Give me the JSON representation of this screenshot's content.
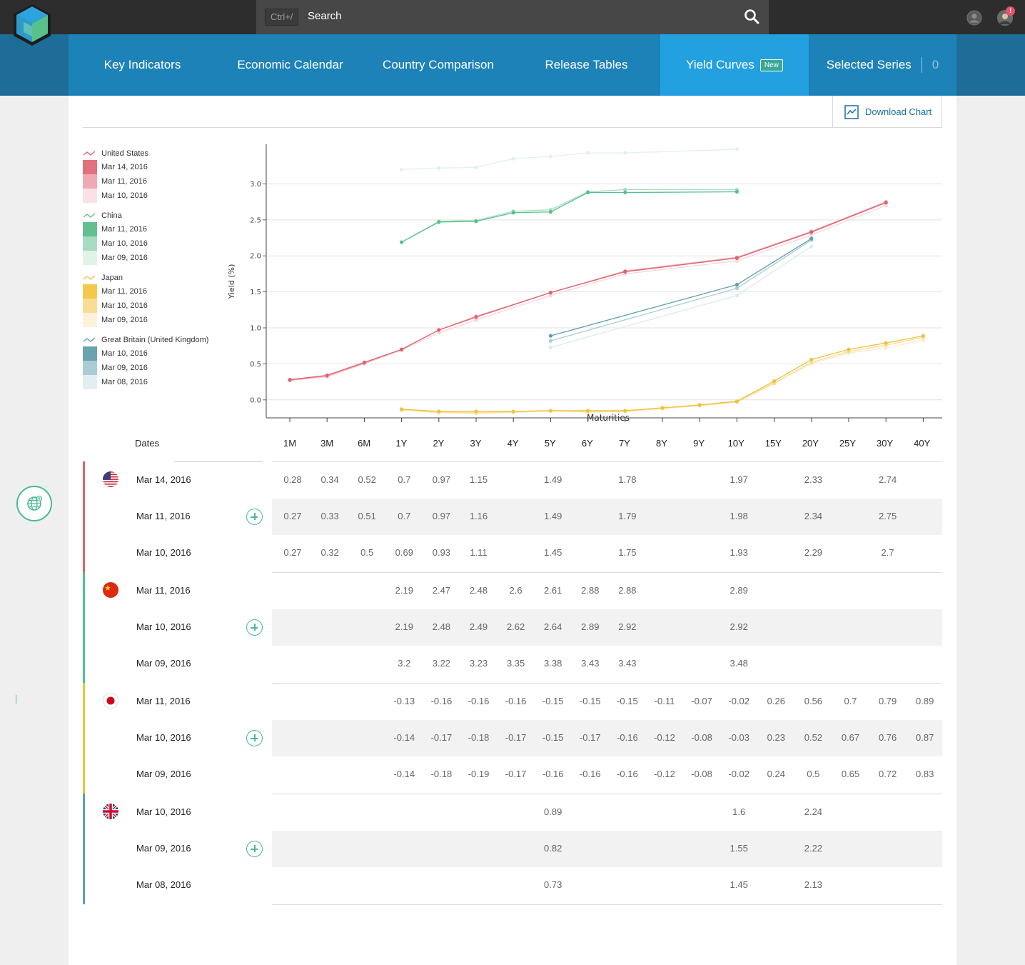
{
  "search": {
    "shortcut": "Ctrl+/",
    "label": "Search"
  },
  "nav": {
    "items": [
      {
        "label": "Key Indicators"
      },
      {
        "label": "Economic Calendar"
      },
      {
        "label": "Country Comparison"
      },
      {
        "label": "Release Tables"
      },
      {
        "label": "Yield Curves",
        "badge": "New"
      },
      {
        "label": "Selected Series",
        "count": "0"
      }
    ]
  },
  "avatar_badge": "!",
  "download_label": "Download Chart",
  "legend": [
    {
      "country": "United States",
      "color": "#e0606f",
      "dates": [
        "Mar 14, 2016",
        "Mar 11, 2016",
        "Mar 10, 2016"
      ],
      "shades": [
        "#e3707f",
        "#eeaab3",
        "#fae1e4"
      ]
    },
    {
      "country": "China",
      "color": "#57c08d",
      "dates": [
        "Mar 11, 2016",
        "Mar 10, 2016",
        "Mar 09, 2016"
      ],
      "shades": [
        "#62c090",
        "#a8dcc0",
        "#e0f3e8"
      ]
    },
    {
      "country": "Japan",
      "color": "#f0c23c",
      "dates": [
        "Mar 11, 2016",
        "Mar 10, 2016",
        "Mar 09, 2016"
      ],
      "shades": [
        "#f4c84a",
        "#f8dd94",
        "#fdf2d9"
      ]
    },
    {
      "country": "Great Britain (United Kingdom)",
      "color": "#5e9fac",
      "dates": [
        "Mar 10, 2016",
        "Mar 09, 2016",
        "Mar 08, 2016"
      ],
      "shades": [
        "#6aa3b0",
        "#aaccd3",
        "#e2eef0"
      ]
    }
  ],
  "chart_data": {
    "type": "line",
    "ylabel": "Yield (%)",
    "xlabel": "Maturities",
    "ylim": [
      -0.25,
      3.55
    ],
    "yticks": [
      "0.0",
      "0.5",
      "1.0",
      "1.5",
      "2.0",
      "2.5",
      "3.0"
    ],
    "x": [
      "1M",
      "3M",
      "6M",
      "1Y",
      "2Y",
      "3Y",
      "4Y",
      "5Y",
      "6Y",
      "7Y",
      "8Y",
      "9Y",
      "10Y",
      "15Y",
      "20Y",
      "25Y",
      "30Y",
      "40Y"
    ],
    "series": [
      {
        "name": "United States Mar 14, 2016",
        "color": "#e0606f",
        "values": [
          0.28,
          0.34,
          0.52,
          0.7,
          0.97,
          1.15,
          null,
          1.49,
          null,
          1.78,
          null,
          null,
          1.97,
          null,
          2.33,
          null,
          2.74,
          null
        ]
      },
      {
        "name": "United States Mar 11, 2016",
        "color": "#eeaab3",
        "values": [
          0.27,
          0.33,
          0.51,
          0.7,
          0.97,
          1.16,
          null,
          1.49,
          null,
          1.79,
          null,
          null,
          1.98,
          null,
          2.34,
          null,
          2.75,
          null
        ]
      },
      {
        "name": "United States Mar 10, 2016",
        "color": "#f7d6db",
        "values": [
          0.27,
          0.32,
          0.5,
          0.69,
          0.93,
          1.11,
          null,
          1.45,
          null,
          1.75,
          null,
          null,
          1.93,
          null,
          2.29,
          null,
          2.7,
          null
        ]
      },
      {
        "name": "China Mar 11, 2016",
        "color": "#57c08d",
        "values": [
          null,
          null,
          null,
          2.19,
          2.47,
          2.48,
          2.6,
          2.61,
          2.88,
          2.88,
          null,
          null,
          2.89,
          null,
          null,
          null,
          null,
          null
        ]
      },
      {
        "name": "China Mar 10, 2016",
        "color": "#a8dcc0",
        "values": [
          null,
          null,
          null,
          2.19,
          2.48,
          2.49,
          2.62,
          2.64,
          2.89,
          2.92,
          null,
          null,
          2.92,
          null,
          null,
          null,
          null,
          null
        ]
      },
      {
        "name": "China Mar 09, 2016",
        "color": "#dff2e8",
        "values": [
          null,
          null,
          null,
          3.2,
          3.22,
          3.23,
          3.35,
          3.38,
          3.43,
          3.43,
          null,
          null,
          3.48,
          null,
          null,
          null,
          null,
          null
        ]
      },
      {
        "name": "Japan Mar 11, 2016",
        "color": "#f0c23c",
        "values": [
          null,
          null,
          null,
          -0.13,
          -0.16,
          -0.16,
          -0.16,
          -0.15,
          -0.15,
          -0.15,
          -0.11,
          -0.07,
          -0.02,
          0.26,
          0.56,
          0.7,
          0.79,
          0.89
        ]
      },
      {
        "name": "Japan Mar 10, 2016",
        "color": "#f8dd94",
        "values": [
          null,
          null,
          null,
          -0.14,
          -0.17,
          -0.18,
          -0.17,
          -0.15,
          -0.17,
          -0.16,
          -0.12,
          -0.08,
          -0.03,
          0.23,
          0.52,
          0.67,
          0.76,
          0.87
        ]
      },
      {
        "name": "Japan Mar 09, 2016",
        "color": "#fbeccc",
        "values": [
          null,
          null,
          null,
          -0.14,
          -0.18,
          -0.19,
          -0.17,
          -0.16,
          -0.16,
          -0.16,
          -0.12,
          -0.08,
          -0.02,
          0.24,
          0.5,
          0.65,
          0.72,
          0.83
        ]
      },
      {
        "name": "Great Britain (United Kingdom) Mar 10, 2016",
        "color": "#5e9fac",
        "values": [
          null,
          null,
          null,
          null,
          null,
          null,
          null,
          0.89,
          null,
          null,
          null,
          null,
          1.6,
          null,
          2.24,
          null,
          null,
          null
        ]
      },
      {
        "name": "Great Britain (United Kingdom) Mar 09, 2016",
        "color": "#aaccd3",
        "values": [
          null,
          null,
          null,
          null,
          null,
          null,
          null,
          0.82,
          null,
          null,
          null,
          null,
          1.55,
          null,
          2.22,
          null,
          null,
          null
        ]
      },
      {
        "name": "Great Britain (United Kingdom) Mar 08, 2016",
        "color": "#dde9ee",
        "values": [
          null,
          null,
          null,
          null,
          null,
          null,
          null,
          0.73,
          null,
          null,
          null,
          null,
          1.45,
          null,
          2.13,
          null,
          null,
          null
        ]
      }
    ]
  },
  "table": {
    "dates_header": "Dates",
    "groups": [
      {
        "flag": "us",
        "color": "#e0606f",
        "rows": [
          {
            "date": "Mar 14, 2016",
            "values": [
              "0.28",
              "0.34",
              "0.52",
              "0.7",
              "0.97",
              "1.15",
              "",
              "1.49",
              "",
              "1.78",
              "",
              "",
              "1.97",
              "",
              "2.33",
              "",
              "2.74",
              ""
            ]
          },
          {
            "date": "Mar 11, 2016",
            "values": [
              "0.27",
              "0.33",
              "0.51",
              "0.7",
              "0.97",
              "1.16",
              "",
              "1.49",
              "",
              "1.79",
              "",
              "",
              "1.98",
              "",
              "2.34",
              "",
              "2.75",
              ""
            ]
          },
          {
            "date": "Mar 10, 2016",
            "values": [
              "0.27",
              "0.32",
              "0.5",
              "0.69",
              "0.93",
              "1.11",
              "",
              "1.45",
              "",
              "1.75",
              "",
              "",
              "1.93",
              "",
              "2.29",
              "",
              "2.7",
              ""
            ]
          }
        ]
      },
      {
        "flag": "cn",
        "color": "#57c08d",
        "rows": [
          {
            "date": "Mar 11, 2016",
            "values": [
              "",
              "",
              "",
              "2.19",
              "2.47",
              "2.48",
              "2.6",
              "2.61",
              "2.88",
              "2.88",
              "",
              "",
              "2.89",
              "",
              "",
              "",
              "",
              ""
            ]
          },
          {
            "date": "Mar 10, 2016",
            "values": [
              "",
              "",
              "",
              "2.19",
              "2.48",
              "2.49",
              "2.62",
              "2.64",
              "2.89",
              "2.92",
              "",
              "",
              "2.92",
              "",
              "",
              "",
              "",
              ""
            ]
          },
          {
            "date": "Mar 09, 2016",
            "values": [
              "",
              "",
              "",
              "3.2",
              "3.22",
              "3.23",
              "3.35",
              "3.38",
              "3.43",
              "3.43",
              "",
              "",
              "3.48",
              "",
              "",
              "",
              "",
              ""
            ]
          }
        ]
      },
      {
        "flag": "jp",
        "color": "#f0c23c",
        "rows": [
          {
            "date": "Mar 11, 2016",
            "values": [
              "",
              "",
              "",
              "-0.13",
              "-0.16",
              "-0.16",
              "-0.16",
              "-0.15",
              "-0.15",
              "-0.15",
              "-0.11",
              "-0.07",
              "-0.02",
              "0.26",
              "0.56",
              "0.7",
              "0.79",
              "0.89"
            ]
          },
          {
            "date": "Mar 10, 2016",
            "values": [
              "",
              "",
              "",
              "-0.14",
              "-0.17",
              "-0.18",
              "-0.17",
              "-0.15",
              "-0.17",
              "-0.16",
              "-0.12",
              "-0.08",
              "-0.03",
              "0.23",
              "0.52",
              "0.67",
              "0.76",
              "0.87"
            ]
          },
          {
            "date": "Mar 09, 2016",
            "values": [
              "",
              "",
              "",
              "-0.14",
              "-0.18",
              "-0.19",
              "-0.17",
              "-0.16",
              "-0.16",
              "-0.16",
              "-0.12",
              "-0.08",
              "-0.02",
              "0.24",
              "0.5",
              "0.65",
              "0.72",
              "0.83"
            ]
          }
        ]
      },
      {
        "flag": "gb",
        "color": "#5e9fac",
        "rows": [
          {
            "date": "Mar 10, 2016",
            "values": [
              "",
              "",
              "",
              "",
              "",
              "",
              "",
              "0.89",
              "",
              "",
              "",
              "",
              "1.6",
              "",
              "2.24",
              "",
              "",
              ""
            ]
          },
          {
            "date": "Mar 09, 2016",
            "values": [
              "",
              "",
              "",
              "",
              "",
              "",
              "",
              "0.82",
              "",
              "",
              "",
              "",
              "1.55",
              "",
              "2.22",
              "",
              "",
              ""
            ]
          },
          {
            "date": "Mar 08, 2016",
            "values": [
              "",
              "",
              "",
              "",
              "",
              "",
              "",
              "0.73",
              "",
              "",
              "",
              "",
              "1.45",
              "",
              "2.13",
              "",
              "",
              ""
            ]
          }
        ]
      }
    ]
  }
}
